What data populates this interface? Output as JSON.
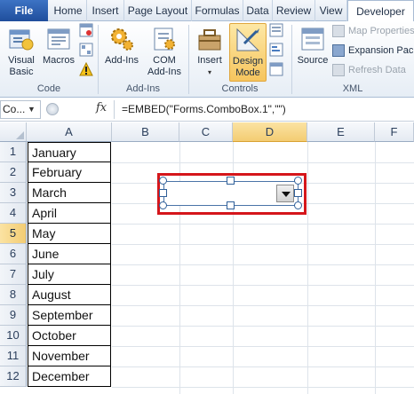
{
  "ribbon": {
    "tabs": [
      "File",
      "Home",
      "Insert",
      "Page Layout",
      "Formulas",
      "Data",
      "Review",
      "View",
      "Developer"
    ],
    "active_tab": "Developer",
    "groups": {
      "code": {
        "label": "Code",
        "visual_basic": "Visual\nBasic",
        "macros": "Macros"
      },
      "addins": {
        "label": "Add-Ins",
        "addins": "Add-Ins",
        "com_addins": "COM\nAdd-Ins"
      },
      "controls": {
        "label": "Controls",
        "insert": "Insert",
        "design_mode": "Design\nMode"
      },
      "xml": {
        "label": "XML",
        "source": "Source",
        "map_properties": "Map Properties",
        "expansion_packs": "Expansion Packs",
        "refresh_data": "Refresh Data"
      }
    }
  },
  "formula_bar": {
    "name_box": "Co...",
    "fx": "fx",
    "formula": "=EMBED(\"Forms.ComboBox.1\",\"\")"
  },
  "grid": {
    "columns": [
      "A",
      "B",
      "C",
      "D",
      "E",
      "F"
    ],
    "selected_column": "D",
    "rows": [
      "1",
      "2",
      "3",
      "4",
      "5",
      "6",
      "7",
      "8",
      "9",
      "10",
      "11",
      "12"
    ],
    "selected_row": "5",
    "column_a_values": [
      "January",
      "February",
      "March",
      "April",
      "May",
      "June",
      "July",
      "August",
      "September",
      "October",
      "November",
      "December"
    ]
  },
  "colors": {
    "highlight_frame": "#d5161b",
    "selected_header": "#f3cc72",
    "file_tab": "#1f4e9c"
  }
}
